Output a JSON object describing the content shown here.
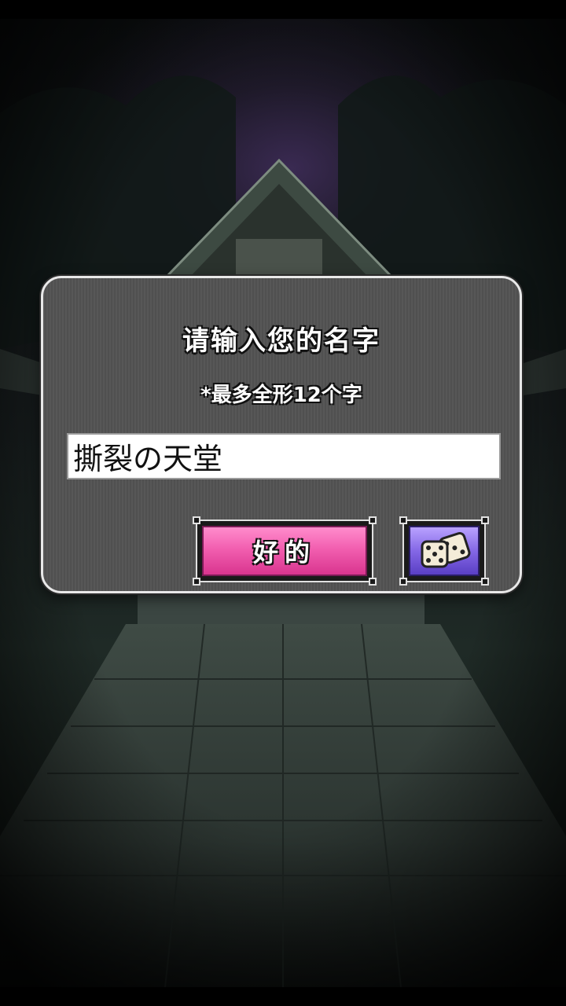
{
  "dialog": {
    "title": "请输入您的名字",
    "hint": "*最多全形12个字",
    "name_value": "撕裂の天堂",
    "ok_label": "好的",
    "random_icon": "dice-icon"
  },
  "colors": {
    "dialog_border": "#e8e8e8",
    "dialog_bg": "#555555",
    "ok_button": "#f25fb0",
    "dice_button": "#8467e6"
  }
}
